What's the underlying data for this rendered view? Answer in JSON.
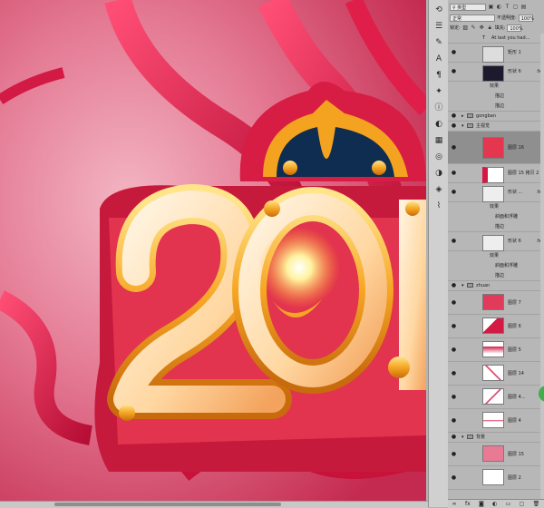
{
  "filter": {
    "kind_label": "类型"
  },
  "blend": {
    "mode": "正常",
    "opacity_label": "不透明度:",
    "opacity_value": "100%"
  },
  "lock": {
    "label": "锁定:",
    "fill_label": "填充:",
    "fill_value": "100%"
  },
  "layers": [
    {
      "kind": "text",
      "name": "At last you had...",
      "visible": false
    },
    {
      "kind": "layer",
      "name": "矩形 1",
      "visible": true,
      "thumb": "rect"
    },
    {
      "kind": "layer",
      "name": "形状 6",
      "visible": true,
      "thumb": "dark",
      "fx": "fx",
      "effects": [
        "效果",
        "描边",
        "描边"
      ]
    },
    {
      "kind": "group",
      "name": "gongban",
      "visible": true,
      "expanded": false
    },
    {
      "kind": "group",
      "name": "主视觉",
      "visible": true,
      "expanded": true
    },
    {
      "kind": "layer",
      "name": "图层 16",
      "visible": true,
      "thumb": "art",
      "selected": true
    },
    {
      "kind": "layer",
      "name": "图层 15 拷贝 2",
      "visible": true,
      "thumb": "strip"
    },
    {
      "kind": "layer",
      "name": "形状 ...",
      "visible": true,
      "thumb": "pattern",
      "fx": "fx",
      "effects": [
        "效果",
        "斜面和浮雕",
        "描边"
      ]
    },
    {
      "kind": "layer",
      "name": "形状 6",
      "visible": true,
      "thumb": "pattern",
      "fx": "fx",
      "effects": [
        "效果",
        "斜面和浮雕",
        "描边"
      ]
    },
    {
      "kind": "group",
      "name": "zhuan",
      "visible": true,
      "expanded": true
    },
    {
      "kind": "layer",
      "name": "图层 7",
      "visible": true,
      "thumb": "red"
    },
    {
      "kind": "layer",
      "name": "图层 6",
      "visible": true,
      "thumb": "red2"
    },
    {
      "kind": "layer",
      "name": "图层 5",
      "visible": true,
      "thumb": "red3"
    },
    {
      "kind": "layer",
      "name": "图层 14",
      "visible": true,
      "thumb": "tri"
    },
    {
      "kind": "layer",
      "name": "图层 4...",
      "visible": true,
      "thumb": "tri"
    },
    {
      "kind": "layer",
      "name": "图层 4",
      "visible": true,
      "thumb": "tri"
    },
    {
      "kind": "group",
      "name": "背景",
      "visible": true,
      "expanded": true
    },
    {
      "kind": "layer",
      "name": "图层 15",
      "visible": true,
      "thumb": "pink"
    },
    {
      "kind": "layer",
      "name": "图层 2",
      "visible": true,
      "thumb": "white"
    }
  ],
  "colors": {
    "canvas_bg": "#d9496a",
    "accent_gold": "#f5b02e",
    "ribbon": "#c8123a",
    "panel_bg": "#b7b7b7",
    "selected": "#8f8f8f"
  },
  "footer_icons": [
    "link-icon",
    "fx-icon",
    "mask-icon",
    "adjustment-icon",
    "group-icon",
    "new-layer-icon",
    "trash-icon"
  ]
}
